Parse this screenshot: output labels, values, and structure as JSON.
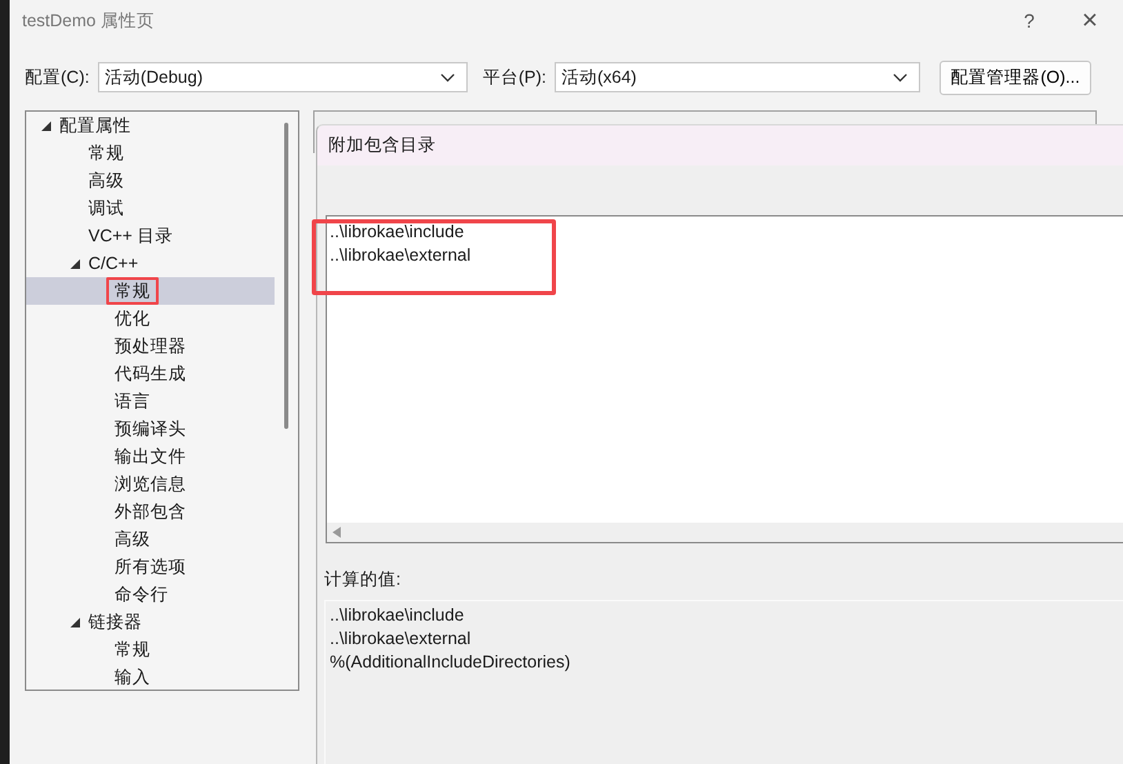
{
  "window": {
    "title": "testDemo 属性页",
    "help": "?",
    "close": "×"
  },
  "config_bar": {
    "config_label": "配置(C):",
    "config_value": "活动(Debug)",
    "platform_label": "平台(P):",
    "platform_value": "活动(x64)",
    "manager_button": "配置管理器(O)..."
  },
  "tree": [
    {
      "label": "配置属性",
      "expanded": true,
      "selected": false,
      "highlighted": false,
      "children": [
        {
          "label": "常规",
          "selected": false,
          "highlighted": false
        },
        {
          "label": "高级",
          "selected": false,
          "highlighted": false
        },
        {
          "label": "调试",
          "selected": false,
          "highlighted": false
        },
        {
          "label": "VC++ 目录",
          "selected": false,
          "highlighted": false
        },
        {
          "label": "C/C++",
          "expanded": true,
          "selected": false,
          "highlighted": false,
          "children": [
            {
              "label": "常规",
              "selected": true,
              "highlighted": true
            },
            {
              "label": "优化",
              "selected": false,
              "highlighted": false
            },
            {
              "label": "预处理器",
              "selected": false,
              "highlighted": false
            },
            {
              "label": "代码生成",
              "selected": false,
              "highlighted": false
            },
            {
              "label": "语言",
              "selected": false,
              "highlighted": false
            },
            {
              "label": "预编译头",
              "selected": false,
              "highlighted": false
            },
            {
              "label": "输出文件",
              "selected": false,
              "highlighted": false
            },
            {
              "label": "浏览信息",
              "selected": false,
              "highlighted": false
            },
            {
              "label": "外部包含",
              "selected": false,
              "highlighted": false
            },
            {
              "label": "高级",
              "selected": false,
              "highlighted": false
            },
            {
              "label": "所有选项",
              "selected": false,
              "highlighted": false
            },
            {
              "label": "命令行",
              "selected": false,
              "highlighted": false
            }
          ]
        },
        {
          "label": "链接器",
          "expanded": true,
          "selected": false,
          "highlighted": false,
          "children": [
            {
              "label": "常规",
              "selected": false,
              "highlighted": false
            },
            {
              "label": "输入",
              "selected": false,
              "highlighted": false
            }
          ]
        }
      ]
    }
  ],
  "popup": {
    "title": "附加包含目录",
    "editor_lines": [
      "..\\librokae\\include",
      "..\\librokae\\external"
    ],
    "editor_highlighted": true,
    "computed_label": "计算的值:",
    "computed_lines": [
      "..\\librokae\\include",
      "..\\librokae\\external",
      "%(AdditionalIncludeDirectories)"
    ]
  }
}
